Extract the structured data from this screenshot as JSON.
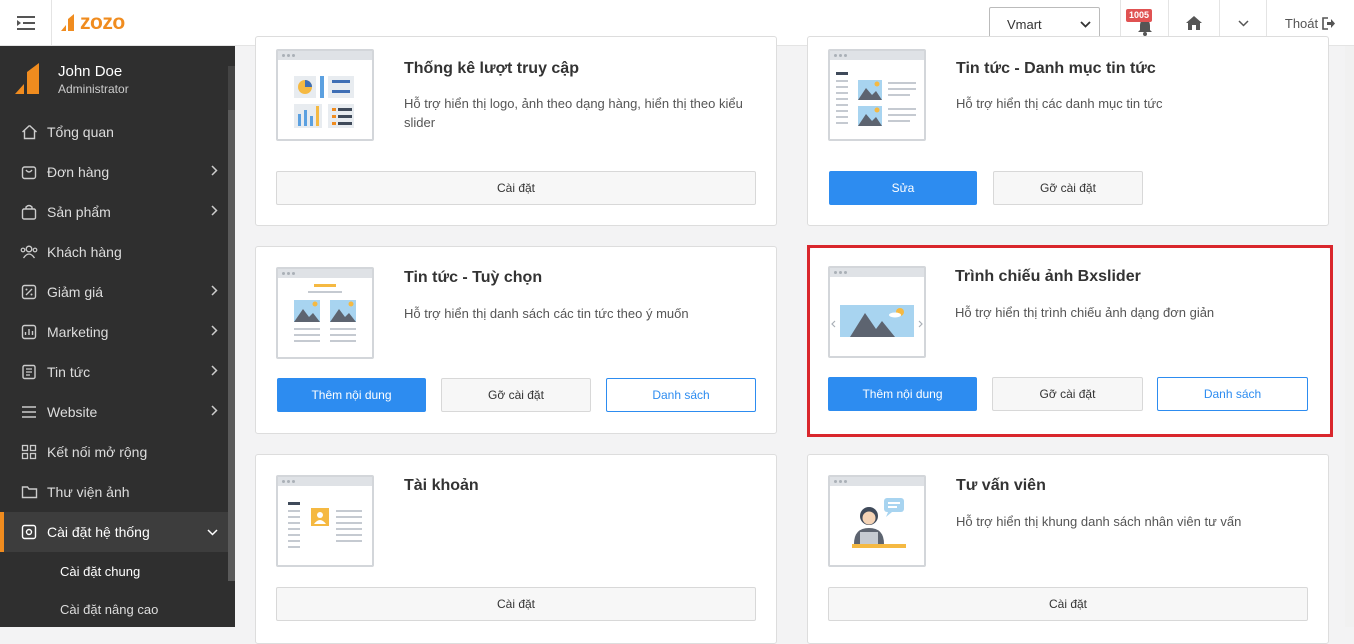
{
  "logo": {
    "text": "zozo"
  },
  "topbar": {
    "store": "Vmart",
    "notification_count": "1005",
    "logout_label": "Thoát"
  },
  "user": {
    "name": "John Doe",
    "role": "Administrator"
  },
  "sidebar": {
    "items": [
      {
        "label": "Tổng quan",
        "icon": "home-icon"
      },
      {
        "label": "Đơn hàng",
        "icon": "cart-icon"
      },
      {
        "label": "Sản phẩm",
        "icon": "bag-icon"
      },
      {
        "label": "Khách hàng",
        "icon": "users-icon"
      },
      {
        "label": "Giảm giá",
        "icon": "discount-icon"
      },
      {
        "label": "Marketing",
        "icon": "marketing-icon"
      },
      {
        "label": "Tin tức",
        "icon": "news-icon"
      },
      {
        "label": "Website",
        "icon": "website-icon"
      },
      {
        "label": "Kết nối mở rộng",
        "icon": "apps-icon"
      },
      {
        "label": "Thư viện ảnh",
        "icon": "folder-icon"
      },
      {
        "label": "Cài đặt hệ thống",
        "icon": "settings-icon"
      }
    ],
    "sub_items": [
      {
        "label": "Cài đặt chung"
      },
      {
        "label": "Cài đặt nâng cao"
      }
    ]
  },
  "cards": [
    {
      "title": "Thống kê lượt truy cập",
      "desc": "Hỗ trợ hiển thị logo, ảnh theo dạng hàng, hiển thị theo kiểu slider",
      "buttons": [
        "Cài đặt"
      ]
    },
    {
      "title": "Tin tức - Danh mục tin tức",
      "desc": "Hỗ trợ hiển thị các danh mục tin tức",
      "buttons": [
        "Sửa",
        "Gỡ cài đặt"
      ]
    },
    {
      "title": "Tin tức - Tuỳ chọn",
      "desc": "Hỗ trợ hiển thị danh sách các tin tức theo ý muốn",
      "buttons": [
        "Thêm nội dung",
        "Gỡ cài đặt",
        "Danh sách"
      ]
    },
    {
      "title": "Trình chiếu ảnh Bxslider",
      "desc": "Hỗ trợ hiển thị trình chiếu ảnh dạng đơn giản",
      "buttons": [
        "Thêm nội dung",
        "Gỡ cài đặt",
        "Danh sách"
      ]
    },
    {
      "title": "Tài khoản",
      "desc": "",
      "buttons": [
        "Cài đặt"
      ]
    },
    {
      "title": "Tư vấn viên",
      "desc": "Hỗ trợ hiển thị khung danh sách nhân viên tư vấn",
      "buttons": [
        "Cài đặt"
      ]
    }
  ],
  "colors": {
    "accent": "#f08c1f",
    "primary": "#2d8cf0",
    "highlight": "#d9262c",
    "sidebar": "#2f2f2f"
  }
}
